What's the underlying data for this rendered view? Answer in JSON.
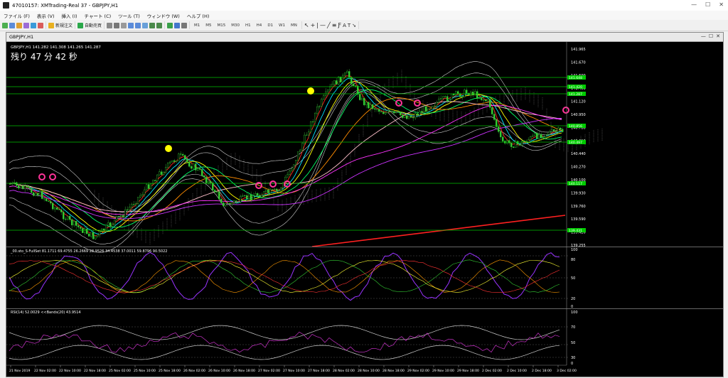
{
  "window": {
    "title": "47010157: XMTrading-Real 37 - GBPJPY,H1",
    "btn_min": "—",
    "btn_max": "☐",
    "btn_close": "✕"
  },
  "menu": [
    "ファイル (F)",
    "表示 (V)",
    "挿入 (I)",
    "チャート (C)",
    "ツール (T)",
    "ウィンドウ (W)",
    "ヘルプ (H)"
  ],
  "toolbar": {
    "new_order": "新規注文",
    "auto_trade": "自動売買",
    "timeframes": [
      "M1",
      "M5",
      "M15",
      "M30",
      "H1",
      "H4",
      "D1",
      "W1",
      "MN"
    ]
  },
  "chart": {
    "tab_title": "GBPJPY,H1",
    "ohlc_header": "GBPJPY,H1  141.282 141.308 141.265 141.287",
    "countdown": "残り 47 分 42 秒",
    "price_scale": [
      "141.965",
      "141.670",
      "141.600",
      "141.450",
      "141.120",
      "140.950",
      "140.780",
      "140.610",
      "140.440",
      "140.270",
      "140.100",
      "139.930",
      "139.760",
      "139.590",
      "139.420",
      "139.255"
    ],
    "price_tags": [
      {
        "label": "141.648",
        "color": "#00cc00"
      },
      {
        "label": "141.420",
        "color": "#00cc00"
      },
      {
        "label": "141.287",
        "color": "#00cc00"
      },
      {
        "label": "140.856",
        "color": "#00cc00"
      },
      {
        "label": "140.497",
        "color": "#00cc00"
      },
      {
        "label": "140.117",
        "color": "#00cc00"
      },
      {
        "label": "139.431",
        "color": "#00cc00"
      }
    ],
    "stoch_header": "_00.sto_S-FullSet 81.1711 69.4755 26.2669 28.9526 34.4538 37.0011 59.8796 90.5022",
    "stoch_scale": [
      "100",
      "80",
      "50",
      "20",
      "0"
    ],
    "rsi_header": "RSI(14) 52.0029  <<Bands(20) 43.9514",
    "rsi_scale": [
      "100",
      "70",
      "50",
      "30",
      "0"
    ],
    "time_labels": [
      "21 Nov 2019",
      "22 Nov 02:00",
      "22 Nov 10:00",
      "22 Nov 18:00",
      "25 Nov 02:00",
      "25 Nov 10:00",
      "25 Nov 18:00",
      "26 Nov 02:00",
      "26 Nov 10:00",
      "26 Nov 18:00",
      "27 Nov 02:00",
      "27 Nov 10:00",
      "27 Nov 18:00",
      "28 Nov 02:00",
      "28 Nov 10:00",
      "28 Nov 18:00",
      "29 Nov 02:00",
      "29 Nov 10:00",
      "29 Nov 18:00",
      "2 Dec 02:00",
      "2 Dec 10:00",
      "2 Dec 18:00",
      "3 Dec 02:00"
    ]
  }
}
